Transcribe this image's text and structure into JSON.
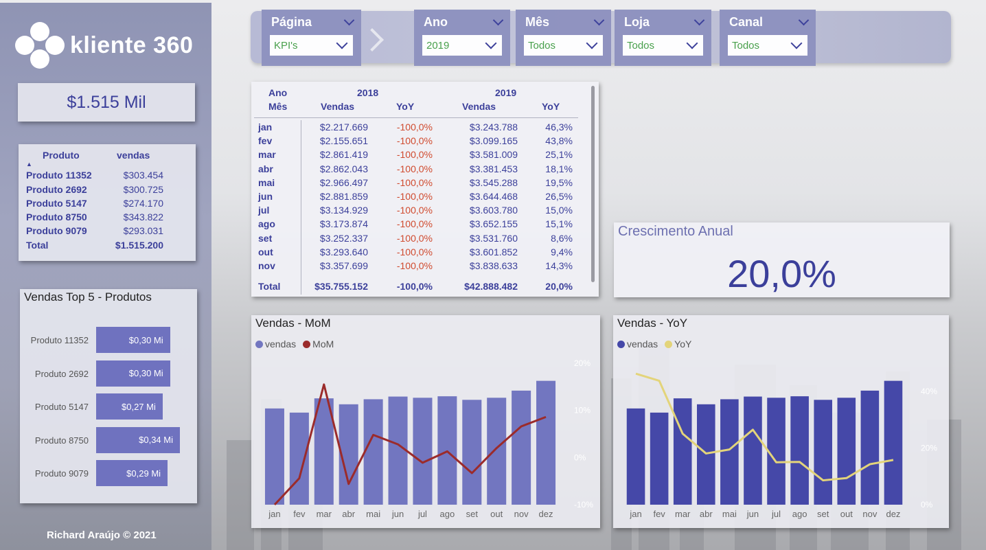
{
  "brand": {
    "logo_text": "kliente 360"
  },
  "sidebar": {
    "kpi_total": "$1.515 Mil",
    "product_table": {
      "col1": "Produto",
      "col2": "vendas",
      "rows": [
        {
          "name": "Produto 11352",
          "value": "$303.454"
        },
        {
          "name": "Produto 2692",
          "value": "$300.725"
        },
        {
          "name": "Produto 5147",
          "value": "$274.170"
        },
        {
          "name": "Produto 8750",
          "value": "$343.822"
        },
        {
          "name": "Produto 9079",
          "value": "$293.031"
        }
      ],
      "total_label": "Total",
      "total_value": "$1.515.200"
    },
    "top5": {
      "title": "Vendas Top 5 - Produtos",
      "bars": [
        {
          "label": "Produto 11352",
          "value": 0.3,
          "text": "$0,30 Mi"
        },
        {
          "label": "Produto 2692",
          "value": 0.3,
          "text": "$0,30 Mi"
        },
        {
          "label": "Produto 5147",
          "value": 0.27,
          "text": "$0,27 Mi"
        },
        {
          "label": "Produto 8750",
          "value": 0.34,
          "text": "$0,34 Mi"
        },
        {
          "label": "Produto 9079",
          "value": 0.29,
          "text": "$0,29 Mi"
        }
      ]
    },
    "footer": "Richard Araújo © 2021"
  },
  "filters": {
    "pagina": {
      "label": "Página",
      "value": "KPI's"
    },
    "ano": {
      "label": "Ano",
      "value": "2019"
    },
    "mes": {
      "label": "Mês",
      "value": "Todos"
    },
    "loja": {
      "label": "Loja",
      "value": "Todos"
    },
    "canal": {
      "label": "Canal",
      "value": "Todos"
    }
  },
  "matrix": {
    "h_ano": "Ano",
    "h_mes": "Mês",
    "year1": "2018",
    "year2": "2019",
    "h_vendas": "Vendas",
    "h_yoy": "YoY",
    "rows": [
      {
        "m": "jan",
        "v18": "$2.217.669",
        "y18": "-100,0%",
        "v19": "$3.243.788",
        "y19": "46,3%"
      },
      {
        "m": "fev",
        "v18": "$2.155.651",
        "y18": "-100,0%",
        "v19": "$3.099.165",
        "y19": "43,8%"
      },
      {
        "m": "mar",
        "v18": "$2.861.419",
        "y18": "-100,0%",
        "v19": "$3.581.009",
        "y19": "25,1%"
      },
      {
        "m": "abr",
        "v18": "$2.862.043",
        "y18": "-100,0%",
        "v19": "$3.381.453",
        "y19": "18,1%"
      },
      {
        "m": "mai",
        "v18": "$2.966.497",
        "y18": "-100,0%",
        "v19": "$3.545.288",
        "y19": "19,5%"
      },
      {
        "m": "jun",
        "v18": "$2.881.859",
        "y18": "-100,0%",
        "v19": "$3.644.468",
        "y19": "26,5%"
      },
      {
        "m": "jul",
        "v18": "$3.134.929",
        "y18": "-100,0%",
        "v19": "$3.603.780",
        "y19": "15,0%"
      },
      {
        "m": "ago",
        "v18": "$3.173.874",
        "y18": "-100,0%",
        "v19": "$3.652.155",
        "y19": "15,1%"
      },
      {
        "m": "set",
        "v18": "$3.252.337",
        "y18": "-100,0%",
        "v19": "$3.531.760",
        "y19": "8,6%"
      },
      {
        "m": "out",
        "v18": "$3.293.640",
        "y18": "-100,0%",
        "v19": "$3.601.852",
        "y19": "9,4%"
      },
      {
        "m": "nov",
        "v18": "$3.357.699",
        "y18": "-100,0%",
        "v19": "$3.838.633",
        "y19": "14,3%"
      }
    ],
    "total": {
      "m": "Total",
      "v18": "$35.755.152",
      "y18": "-100,0%",
      "v19": "$42.888.482",
      "y19": "20,0%"
    }
  },
  "crescimento": {
    "title": "Crescimento Anual",
    "value": "20,0%"
  },
  "chart_data": [
    {
      "type": "bar",
      "title": "Vendas - MoM",
      "categories": [
        "jan",
        "fev",
        "mar",
        "abr",
        "mai",
        "jun",
        "jul",
        "ago",
        "set",
        "out",
        "nov",
        "dez"
      ],
      "series": [
        {
          "name": "vendas",
          "values": [
            3.24,
            3.1,
            3.58,
            3.38,
            3.55,
            3.64,
            3.6,
            3.65,
            3.53,
            3.6,
            3.84,
            4.17
          ]
        },
        {
          "name": "MoM",
          "type": "line",
          "values": [
            -10.0,
            -4.4,
            15.5,
            -5.6,
            4.8,
            2.8,
            -1.1,
            1.3,
            -3.3,
            2.0,
            6.6,
            8.6
          ]
        }
      ],
      "y2_ticks": [
        "20%",
        "10%",
        "0%",
        "-10%"
      ],
      "y2lim": [
        -10,
        20
      ],
      "colors": {
        "vendas": "#7276c0",
        "MoM": "#9b2b2b"
      }
    },
    {
      "type": "bar",
      "title": "Vendas - YoY",
      "categories": [
        "jan",
        "fev",
        "mar",
        "abr",
        "mai",
        "jun",
        "jul",
        "ago",
        "set",
        "out",
        "nov",
        "dez"
      ],
      "series": [
        {
          "name": "vendas",
          "values": [
            3.24,
            3.1,
            3.58,
            3.38,
            3.55,
            3.64,
            3.6,
            3.65,
            3.53,
            3.6,
            3.84,
            4.17
          ]
        },
        {
          "name": "YoY",
          "type": "line",
          "values": [
            46.3,
            43.8,
            25.1,
            18.1,
            19.5,
            26.5,
            15.0,
            15.1,
            8.6,
            9.4,
            14.3,
            15.8
          ]
        }
      ],
      "y2_ticks": [
        "40%",
        "20%",
        "0%"
      ],
      "y2lim": [
        0,
        50
      ],
      "colors": {
        "vendas": "#4548a8",
        "YoY": "#e3d47a"
      }
    }
  ]
}
